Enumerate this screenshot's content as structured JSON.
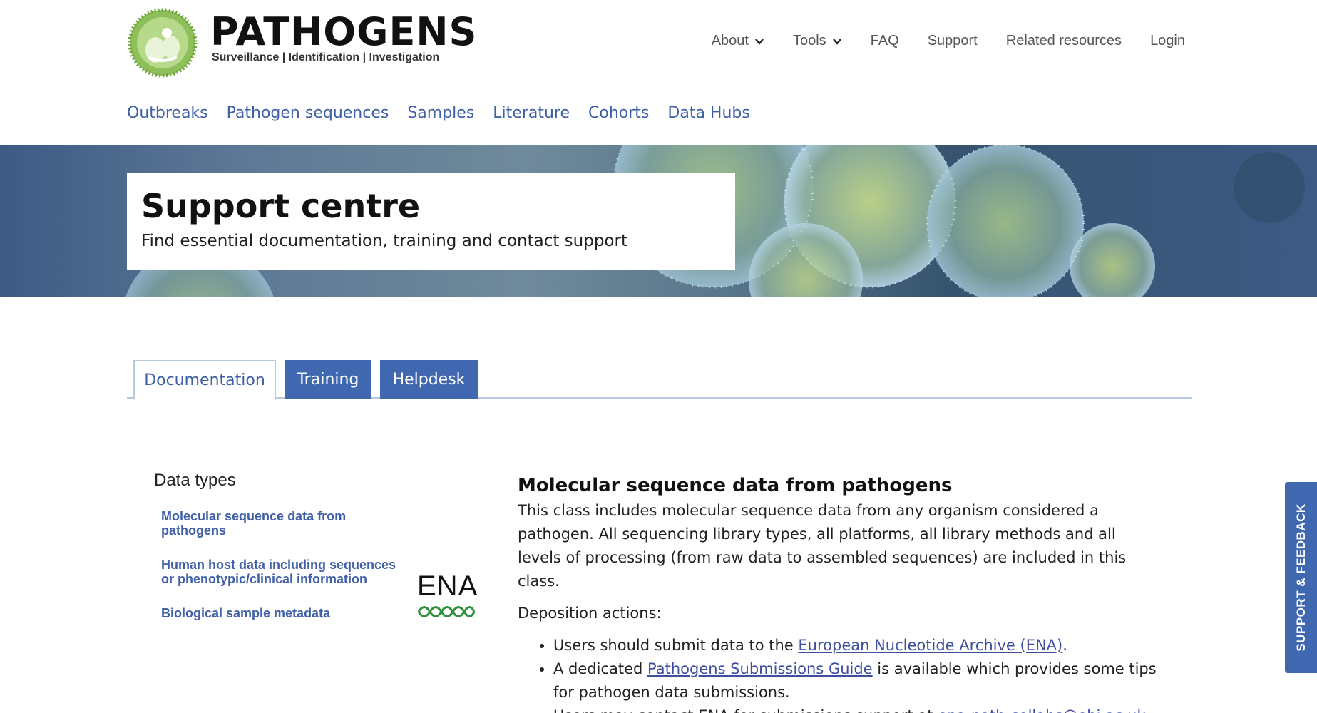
{
  "brand": {
    "name": "PATHOGENS",
    "tagline": "Surveillance | Identification | Investigation"
  },
  "topnav": [
    {
      "label": "About",
      "dropdown": true
    },
    {
      "label": "Tools",
      "dropdown": true
    },
    {
      "label": "FAQ"
    },
    {
      "label": "Support"
    },
    {
      "label": "Related resources"
    },
    {
      "label": "Login"
    }
  ],
  "mainnav": [
    "Outbreaks",
    "Pathogen sequences",
    "Samples",
    "Literature",
    "Cohorts",
    "Data Hubs"
  ],
  "hero": {
    "title": "Support centre",
    "subtitle": "Find essential documentation, training and contact support"
  },
  "tabs": [
    "Documentation",
    "Training",
    "Helpdesk"
  ],
  "sidebar": {
    "title": "Data types",
    "items": [
      "Molecular sequence data from pathogens",
      "Human host data including sequences or phenotypic/clinical information",
      "Biological sample metadata"
    ]
  },
  "ena_logo_text": "ENA",
  "content": {
    "heading": "Molecular sequence data from pathogens",
    "intro": "This class includes molecular sequence data from any organism considered a pathogen. All sequencing library types, all platforms, all library methods and all levels of processing (from raw data to assembled sequences) are included in this class.",
    "deposition_label": "Deposition actions:",
    "bullet1_pre": "Users should submit data to the ",
    "bullet1_link": "European Nucleotide Archive (ENA)",
    "bullet1_post": ".",
    "bullet2_pre": "A dedicated ",
    "bullet2_link": "Pathogens Submissions Guide",
    "bullet2_post": " is available which provides some tips for pathogen data submissions.",
    "bullet3_pre": "Users may contact ENA for submissions support at ",
    "bullet3_link": "ena-path-collabs@ebi.ac.uk",
    "bullet3_post": "."
  },
  "feedback_label": "SUPPORT & FEEDBACK",
  "colors": {
    "link": "#3f5fa6",
    "tab_blue": "#3f68b1"
  }
}
